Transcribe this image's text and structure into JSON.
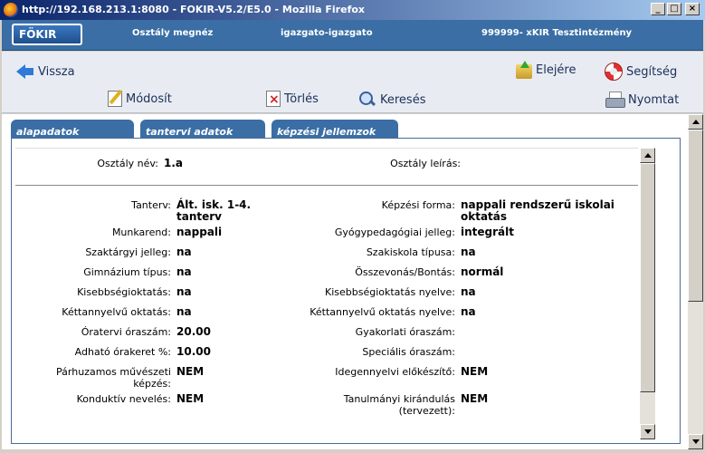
{
  "window": {
    "title": "http://192.168.213.1:8080 - FOKIR-V5.2/E5.0 - Mozilla Firefox",
    "buttons": {
      "minimize": "_",
      "maximize": "□",
      "close": "×"
    }
  },
  "header": {
    "logo": "FÖKIR",
    "page_title": "Osztály megnéz",
    "user": "igazgato-igazgato",
    "institution": "999999- xKIR Tesztintézmény"
  },
  "nav": {
    "back": "Vissza",
    "top": "Elejére",
    "help": "Segítség",
    "edit": "Módosít",
    "delete": "Törlés",
    "search": "Keresés",
    "print": "Nyomtat"
  },
  "tabs": [
    "alapadatok",
    "tantervi adatok",
    "képzési jellemzok"
  ],
  "active_tab": "tantervi adatok",
  "class_info": {
    "name_label": "Osztály név:",
    "name_value": "1.a",
    "desc_label": "Osztály leírás:",
    "desc_value": ""
  },
  "fields_left": [
    {
      "label": "Tanterv:",
      "value": "Ált. isk. 1-4. tanterv"
    },
    {
      "label": "Munkarend:",
      "value": "nappali"
    },
    {
      "label": "Szaktárgyi jelleg:",
      "value": "na"
    },
    {
      "label": "Gimnázium típus:",
      "value": "na"
    },
    {
      "label": "Kisebbségioktatás:",
      "value": "na"
    },
    {
      "label": "Kéttannyelvű oktatás:",
      "value": "na"
    },
    {
      "label": "Óratervi óraszám:",
      "value": "20.00"
    },
    {
      "label": "Adható órakeret %:",
      "value": "10.00"
    },
    {
      "label": "Párhuzamos művészeti képzés:",
      "value": "NEM"
    },
    {
      "label": "Konduktív nevelés:",
      "value": "NEM"
    }
  ],
  "fields_right": [
    {
      "label": "Képzési forma:",
      "value": "nappali rendszerű iskolai oktatás"
    },
    {
      "label": "Gyógypedagógiai jelleg:",
      "value": "integrált"
    },
    {
      "label": "Szakiskola típusa:",
      "value": "na"
    },
    {
      "label": "Összevonás/Bontás:",
      "value": "normál"
    },
    {
      "label": "Kisebbségioktatás nyelve:",
      "value": "na"
    },
    {
      "label": "Kéttannyelvű oktatás nyelve:",
      "value": "na"
    },
    {
      "label": "Gyakorlati óraszám:",
      "value": ""
    },
    {
      "label": "Speciális óraszám:",
      "value": ""
    },
    {
      "label": "Idegennyelvi előkészítő:",
      "value": "NEM"
    },
    {
      "label": "Tanulmányi kirándulás (tervezett):",
      "value": "NEM"
    }
  ]
}
